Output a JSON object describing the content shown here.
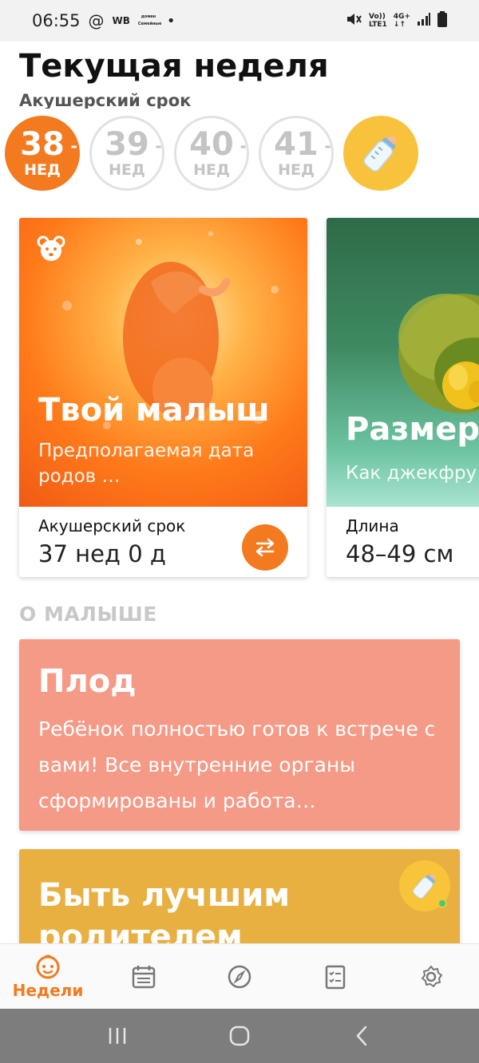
{
  "status_bar": {
    "time": "06:55",
    "at_symbol": "@",
    "wb": "WB",
    "mini_app": "домен\nСемейные",
    "dot": "•",
    "volte": "Vo))\nLTE1",
    "network": "4G+\n↓↑"
  },
  "header": {
    "title": "Текущая неделя",
    "subtitle": "Акушерский срок"
  },
  "weeks": [
    {
      "num": "38",
      "unit": "НЕД",
      "active": true
    },
    {
      "num": "39",
      "unit": "НЕД",
      "active": false
    },
    {
      "num": "40",
      "unit": "НЕД",
      "active": false
    },
    {
      "num": "41",
      "unit": "НЕД",
      "active": false
    }
  ],
  "week_dash": "-",
  "cards": {
    "baby": {
      "title": "Твой малыш",
      "subtitle": "Предполагаемая дата родов …",
      "foot_label": "Акушерский срок",
      "foot_value": "37 нед 0 д"
    },
    "size": {
      "title": "Размер",
      "subtitle": "Как джекфру",
      "foot_label": "Длина",
      "foot_value": "48–49 см"
    }
  },
  "section_title": "О МАЛЫШЕ",
  "info": {
    "fetus": {
      "title": "Плод",
      "text": "Ребёнок полностью готов к встрече с вами! Все внутренние органы сформированы и работа…"
    },
    "parent": {
      "title": "Быть лучшим родителем"
    }
  },
  "bottom_nav": {
    "weeks_label": "Недели",
    "active_color": "#f47a1f",
    "icons": [
      "baby-face-icon",
      "calendar-icon",
      "compass-icon",
      "checklist-icon",
      "gear-icon"
    ]
  },
  "colors": {
    "accent": "#f47a1f",
    "fetus_card": "#f49a87",
    "parent_card": "#e8b041",
    "bottle": "#f9c23c"
  }
}
